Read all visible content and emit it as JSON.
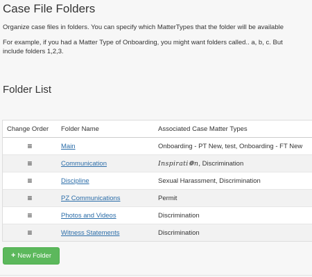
{
  "page": {
    "title": "Case File Folders",
    "description_line1": "Organize case files in folders. You can specify which MatterTypes that the folder will be available",
    "description_line2": "For example, if you had a Matter Type of Onboarding, you might want folders called.. a, b, c. But",
    "description_line3": "include folders 1,2,3."
  },
  "folder_list": {
    "title": "Folder List",
    "columns": {
      "change_order": "Change Order",
      "folder_name": "Folder Name",
      "matter_types": "Associated Case Matter Types"
    },
    "rows": [
      {
        "handle": "≡",
        "name": "Main",
        "types": "Onboarding - PT New, test, Onboarding - FT New"
      },
      {
        "handle": "≡",
        "name": "Communication",
        "types_fancy": "Inspirati❁n",
        "types": ", Discrimination"
      },
      {
        "handle": "≡",
        "name": "Discipline",
        "types": "Sexual Harassment, Discrimination"
      },
      {
        "handle": "≡",
        "name": "PZ Communications",
        "types": "Permit"
      },
      {
        "handle": "≡",
        "name": "Photos and Videos",
        "types": "Discrimination"
      },
      {
        "handle": "≡",
        "name": "Witness Statements",
        "types": "Discrimination"
      }
    ]
  },
  "actions": {
    "new_folder_icon": "+",
    "new_folder_label": "New Folder"
  },
  "colors": {
    "link": "#2a6ca8",
    "primary_button": "#5cb85c",
    "background": "#f7f7f7"
  }
}
